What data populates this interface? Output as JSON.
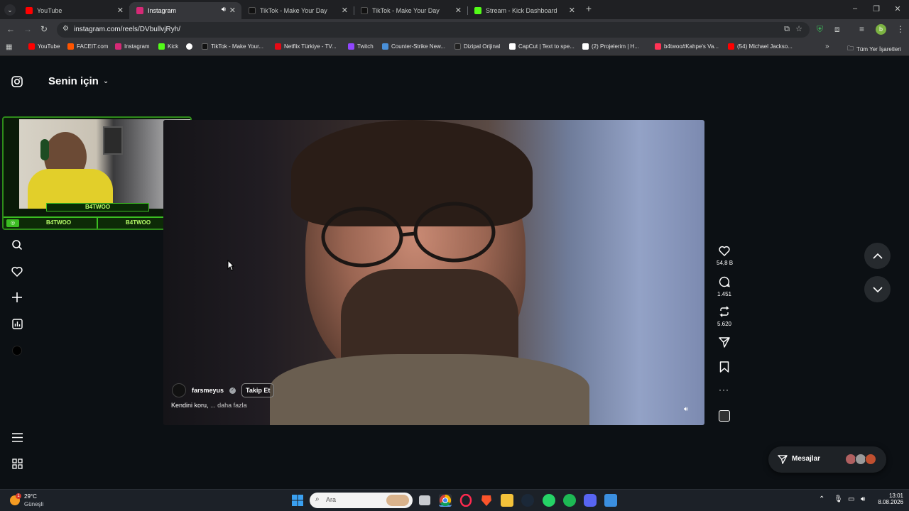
{
  "tabs": [
    {
      "title": "YouTube",
      "color": "#ff0000"
    },
    {
      "title": "Instagram",
      "color": "#d62976"
    },
    {
      "title": "TikTok - Make Your Day",
      "color": "#111111"
    },
    {
      "title": "TikTok - Make Your Day",
      "color": "#111111"
    },
    {
      "title": "Stream - Kick Dashboard",
      "color": "#53fc18"
    }
  ],
  "url": "instagram.com/reels/DVbullvjRyh/",
  "bookmarks": [
    {
      "label": "YouTube",
      "color": "#ff0000"
    },
    {
      "label": "FACEIT.com",
      "color": "#ff5500"
    },
    {
      "label": "Instagram",
      "color": "#d62976"
    },
    {
      "label": "Kick",
      "color": "#53fc18"
    },
    {
      "label": "",
      "color": "#ffffff"
    },
    {
      "label": "TikTok - Make Your...",
      "color": "#111111"
    },
    {
      "label": "Netflix Türkiye - TV...",
      "color": "#e50914"
    },
    {
      "label": "Twitch",
      "color": "#9146ff"
    },
    {
      "label": "Counter-Strike New...",
      "color": "#4a90d9"
    },
    {
      "label": "Dizipal Orijinal",
      "color": "#222222"
    },
    {
      "label": "CapCut | Text to spe...",
      "color": "#ffffff"
    },
    {
      "label": "(2)  Projelerim | H...",
      "color": "#ffffff"
    },
    {
      "label": "b4twoo#Kahpe's Va...",
      "color": "#ff3355"
    },
    {
      "label": "(54) Michael Jackso...",
      "color": "#ff0000"
    }
  ],
  "all_bookmarks_label": "Tüm Yer İşaretleri",
  "feed_title": "Senin için",
  "overlay": {
    "name_top": "B4TWOO",
    "name_left": "B4TWOO",
    "name_right": "B4TWOO"
  },
  "reel": {
    "username": "farsmeyus",
    "follow_label": "Takip Et",
    "caption": "Kendini koru,",
    "more_label": "... daha fazla",
    "likes": "54,8 B",
    "comments": "1.451",
    "reposts": "5.620"
  },
  "messages_label": "Mesajlar",
  "taskbar": {
    "weather_temp": "29°C",
    "weather_desc": "Güneşli",
    "search_placeholder": "Ara",
    "time": "13:01",
    "date": "8.08.2026",
    "notification_badge": "1"
  }
}
